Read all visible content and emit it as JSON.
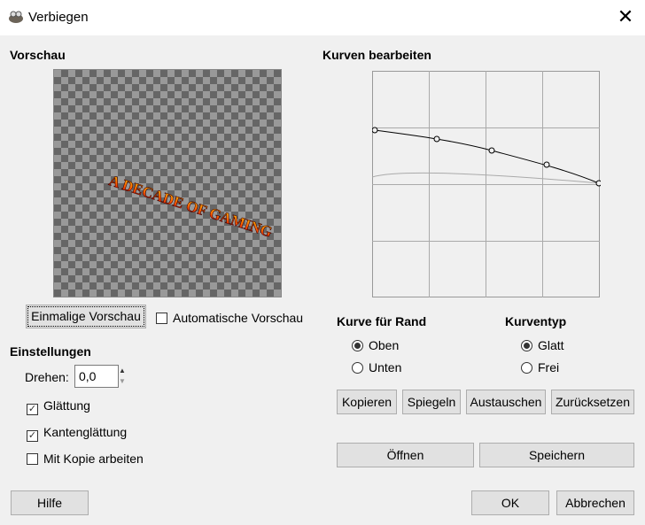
{
  "window": {
    "title": "Verbiegen",
    "close_icon": "close-icon"
  },
  "preview": {
    "heading": "Vorschau",
    "image_text": "A DECADE OF GAMING",
    "once_button": "Einmalige Vorschau",
    "auto_label": "Automatische Vorschau",
    "auto_checked": false
  },
  "settings": {
    "heading": "Einstellungen",
    "rotate_label": "Drehen:",
    "rotate_value": "0,0",
    "smoothing_label": "Glättung",
    "smoothing_checked": true,
    "antialias_label": "Kantenglättung",
    "antialias_checked": true,
    "copy_label": "Mit Kopie arbeiten",
    "copy_checked": false
  },
  "curves": {
    "heading": "Kurven bearbeiten"
  },
  "edge": {
    "heading": "Kurve für Rand",
    "options": [
      "Oben",
      "Unten"
    ],
    "selected": "Oben"
  },
  "type": {
    "heading": "Kurventyp",
    "options": [
      "Glatt",
      "Frei"
    ],
    "selected": "Glatt"
  },
  "buttons": {
    "copy": "Kopieren",
    "mirror": "Spiegeln",
    "swap": "Austauschen",
    "reset": "Zurücksetzen",
    "open": "Öffnen",
    "save": "Speichern",
    "help": "Hilfe",
    "ok": "OK",
    "cancel": "Abbrechen"
  }
}
